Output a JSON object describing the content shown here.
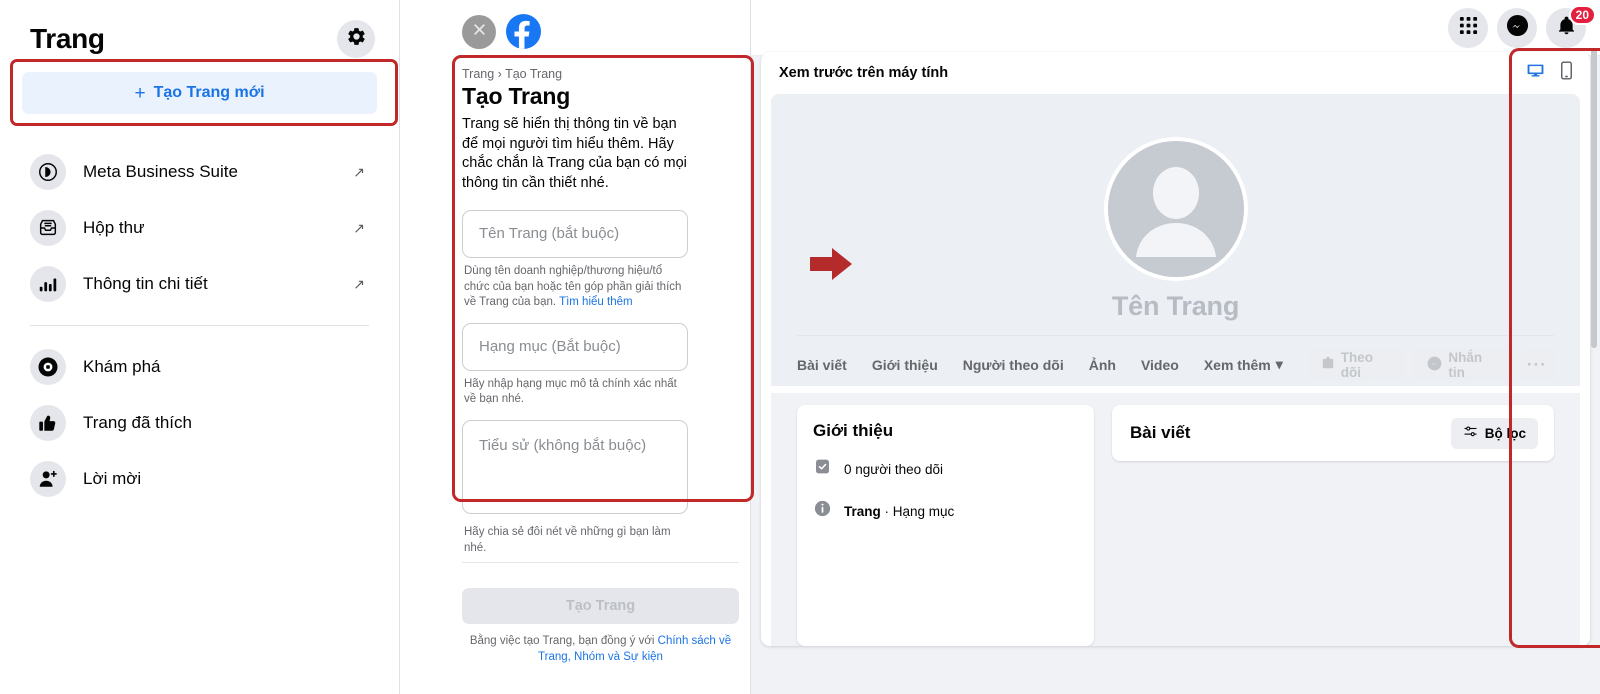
{
  "sidebar": {
    "title": "Trang",
    "gear_icon": "gear-icon",
    "create_button": {
      "label": "Tạo Trang mới",
      "plus": "+"
    },
    "items": [
      {
        "label": "Meta Business Suite",
        "icon": "meta-icon",
        "external": "↗"
      },
      {
        "label": "Hộp thư",
        "icon": "inbox-icon",
        "external": "↗"
      },
      {
        "label": "Thông tin chi tiết",
        "icon": "bar-chart-icon",
        "external": "↗"
      },
      {
        "label": "Khám phá",
        "icon": "compass-icon",
        "external": ""
      },
      {
        "label": "Trang đã thích",
        "icon": "thumbs-up-icon",
        "external": ""
      },
      {
        "label": "Lời mời",
        "icon": "add-person-icon",
        "external": ""
      }
    ]
  },
  "form": {
    "close_icon": "close-icon",
    "brand_icon": "facebook-logo-icon",
    "breadcrumb": "Trang › Tạo Trang",
    "heading": "Tạo Trang",
    "description": "Trang sẽ hiển thị thông tin về bạn để mọi người tìm hiểu thêm. Hãy chắc chắn là Trang của bạn có mọi thông tin cần thiết nhé.",
    "fields": [
      {
        "placeholder": "Tên Trang (bắt buộc)",
        "value": "",
        "hint": "Dùng tên doanh nghiệp/thương hiệu/tổ chức của bạn hoặc tên góp phần giải thích về Trang của bạn.",
        "hint_link": "Tìm hiểu thêm"
      },
      {
        "placeholder": "Hạng mục (Bắt buộc)",
        "value": "",
        "hint": "Hãy nhập hạng mục mô tả chính xác nhất về bạn nhé.",
        "hint_link": ""
      },
      {
        "placeholder": "Tiểu sử (không bắt buộc)",
        "value": "",
        "hint": "Hãy chia sẻ đôi nét về những gì bạn làm nhé.",
        "hint_link": ""
      }
    ],
    "submit_label": "Tạo Trang",
    "terms_prefix": "Bằng việc tạo Trang, bạn đồng ý với ",
    "terms_link": "Chính sách về Trang, Nhóm và Sự kiện"
  },
  "topbar": {
    "icons": [
      {
        "name": "grid-menu-icon",
        "badge": ""
      },
      {
        "name": "messenger-icon",
        "badge": ""
      },
      {
        "name": "bell-notification-icon",
        "badge": "20"
      }
    ]
  },
  "preview": {
    "header_title": "Xem trước trên máy tính",
    "device_toggles": [
      {
        "name": "desktop-icon",
        "active": true
      },
      {
        "name": "mobile-icon",
        "active": false
      }
    ],
    "page_name": "Tên Trang",
    "avatar_icon": "default-avatar-icon",
    "tabs": [
      {
        "label": "Bài viết"
      },
      {
        "label": "Giới thiệu"
      },
      {
        "label": "Người theo dõi"
      },
      {
        "label": "Ảnh"
      },
      {
        "label": "Video"
      },
      {
        "label": "Xem thêm",
        "caret": "▾"
      }
    ],
    "actions": [
      {
        "label": "Theo dõi",
        "icon": "follow-icon"
      },
      {
        "label": "Nhắn tin",
        "icon": "messenger-icon"
      },
      {
        "label": "···",
        "icon": "more-options-icon"
      }
    ],
    "about_card": {
      "title": "Giới thiệu",
      "rows": [
        {
          "icon": "followers-icon",
          "text": "0 người theo dõi",
          "bold_part": ""
        },
        {
          "icon": "info-icon",
          "text": " · Hạng mục",
          "bold_part": "Trang"
        }
      ]
    },
    "posts_card": {
      "title": "Bài viết",
      "filter_label": "Bộ lọc",
      "filter_icon": "filter-sliders-icon"
    }
  },
  "annotations": {
    "arrow": "red-arrow-pointing-right",
    "highlight_color": "#c0282a"
  }
}
